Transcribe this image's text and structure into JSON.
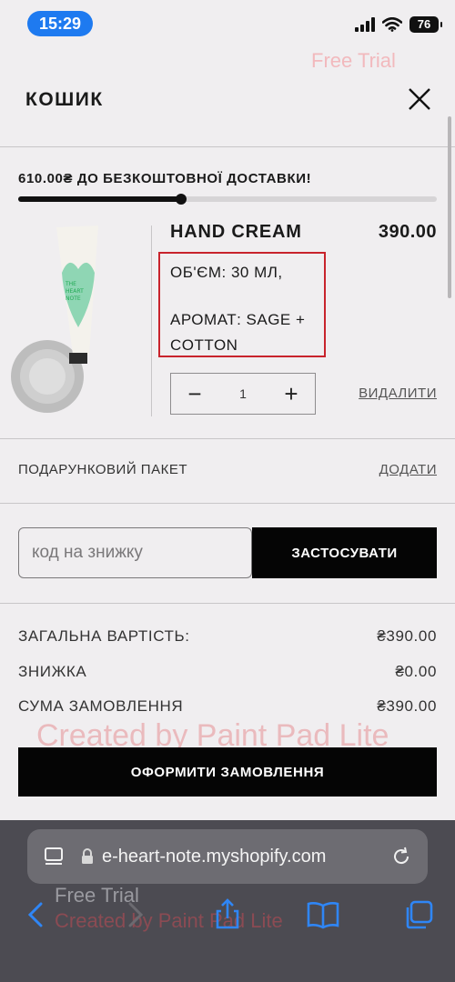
{
  "status_bar": {
    "time": "15:29",
    "battery": "76"
  },
  "watermarks": {
    "top": "Free Trial",
    "center": "Created by Paint Pad Lite",
    "bottom": "Free Trial",
    "bottom_sub": "Created by Paint Pad Lite"
  },
  "header": {
    "title": "КОШИК"
  },
  "shipping": {
    "message": "610.00₴ ДО БЕЗКОШТОВНОЇ ДОСТАВКИ!",
    "progress_fraction": 0.39
  },
  "product": {
    "name": "HAND CREAM",
    "price": "390.00",
    "volume": "ОБ'ЄМ: 30 МЛ,",
    "scent": "АРОМАТ: SAGE + COTTON",
    "quantity": "1",
    "remove_label": "ВИДАЛИТИ",
    "tube_brand": "THE HEART NOTE"
  },
  "gift": {
    "label": "ПОДАРУНКОВИЙ ПАКЕТ",
    "action": "ДОДАТИ"
  },
  "discount": {
    "placeholder": "код на знижку",
    "apply_label": "ЗАСТОСУВАТИ"
  },
  "totals": [
    {
      "label": "ЗАГАЛЬНА ВАРТІСТЬ:",
      "value": "₴390.00"
    },
    {
      "label": "ЗНИЖКА",
      "value": "₴0.00"
    },
    {
      "label": "СУМА ЗАМОВЛЕННЯ",
      "value": "₴390.00"
    }
  ],
  "checkout": {
    "label": "ОФОРМИТИ ЗАМОВЛЕННЯ"
  },
  "browser": {
    "url": "e-heart-note.myshopify.com"
  },
  "colors": {
    "accent": "#1e7af0",
    "highlight_box": "#c8232c",
    "button_bg": "#050505"
  }
}
